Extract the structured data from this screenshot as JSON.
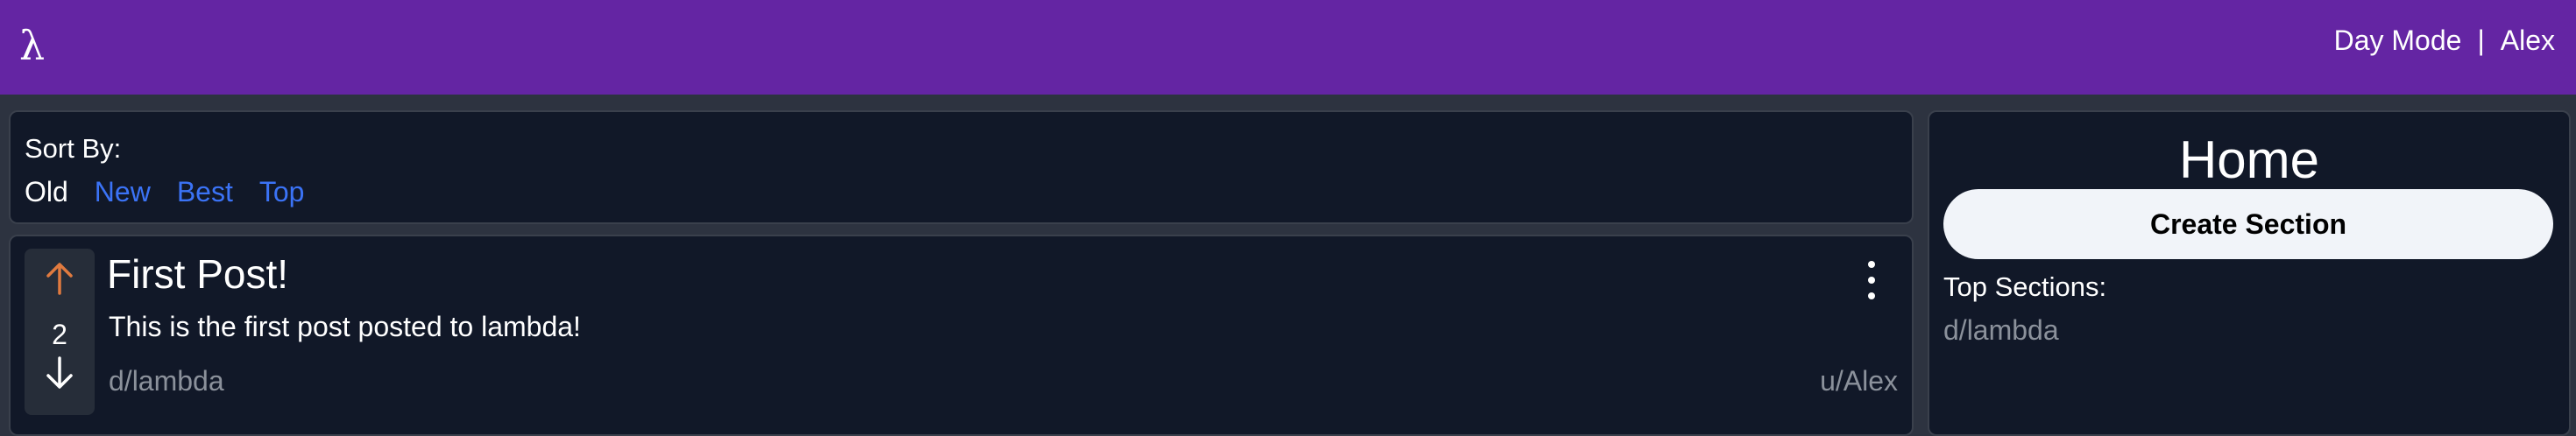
{
  "header": {
    "logo": "λ",
    "nav": {
      "day_mode": "Day Mode",
      "separator": "|",
      "user": "Alex"
    }
  },
  "sort": {
    "label": "Sort By:",
    "options": [
      "Old",
      "New",
      "Best",
      "Top"
    ],
    "active": "Old"
  },
  "post": {
    "votes": "2",
    "title": "First Post!",
    "body": "This is the first post posted to lambda!",
    "section": "d/lambda",
    "author": "u/Alex"
  },
  "sidebar": {
    "title": "Home",
    "create_button": "Create Section",
    "top_sections_label": "Top Sections:",
    "top_sections": [
      "d/lambda"
    ]
  },
  "icons": {
    "upvote": "arrow-up-icon",
    "downvote": "arrow-down-icon",
    "more": "more-vertical-icon"
  },
  "colors": {
    "header_bg": "#6425a3",
    "page_bg": "#2d3340",
    "panel_bg": "#111828",
    "link": "#3b73f6",
    "upvote": "#e07a3f",
    "muted": "#8b919b",
    "button_bg": "#f1f4f9"
  }
}
